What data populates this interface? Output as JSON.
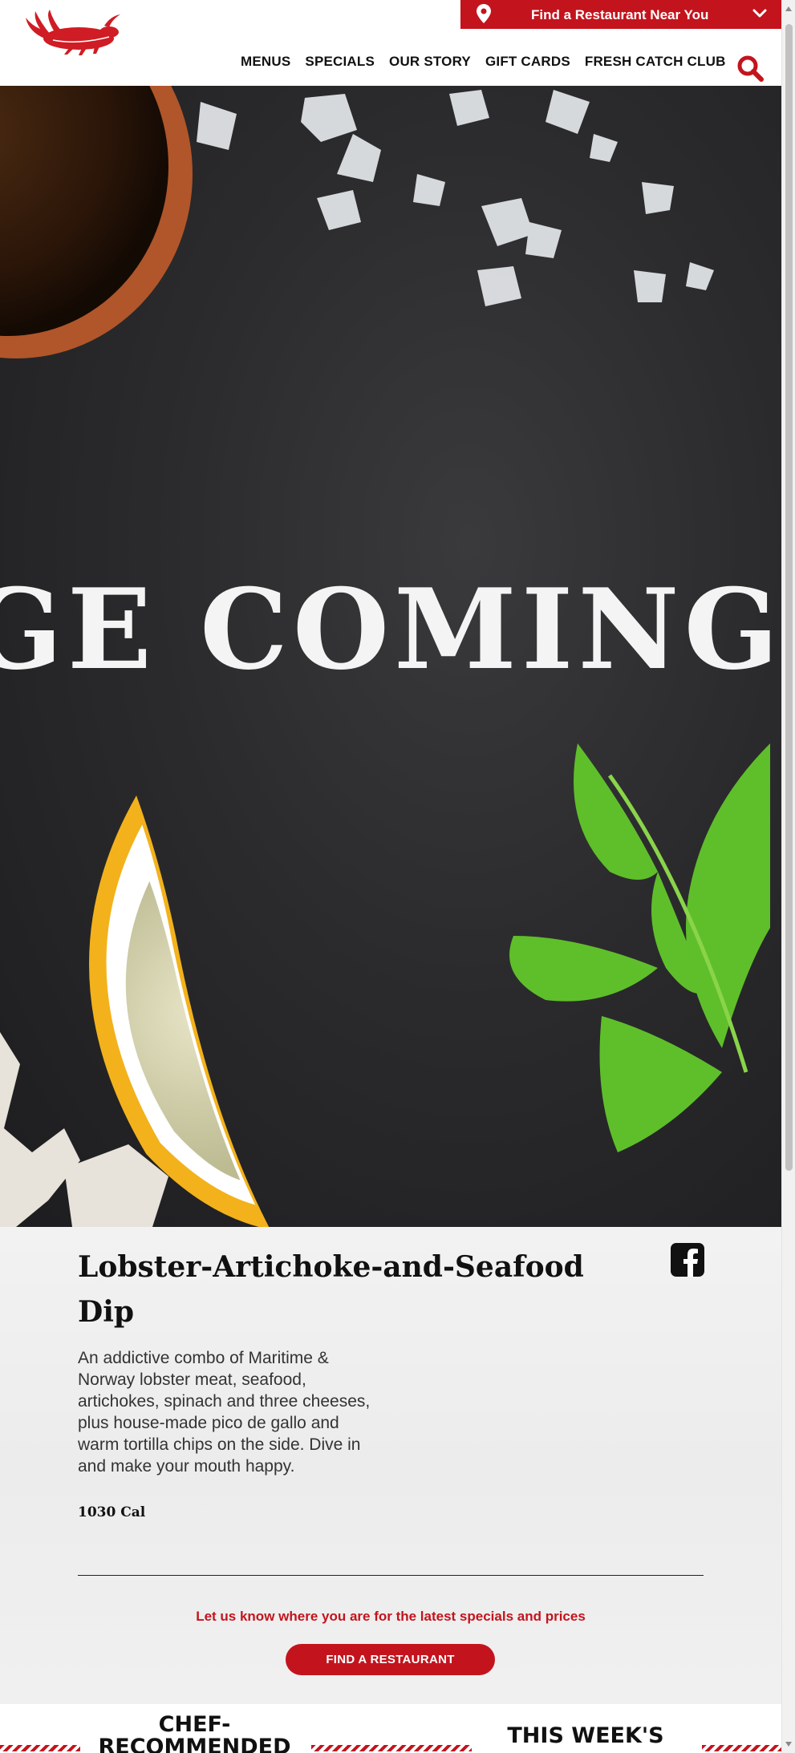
{
  "header": {
    "find_bar_label": "Find a Restaurant Near You",
    "nav": [
      "MENUS",
      "SPECIALS",
      "OUR STORY",
      "GIFT CARDS",
      "FRESH CATCH CLUB"
    ],
    "icons": {
      "logo": "lobster-logo-icon",
      "location": "map-pin-icon",
      "dropdown": "chevron-down-icon",
      "search": "search-icon"
    }
  },
  "hero": {
    "overlay_text": "GE COMING S"
  },
  "dish": {
    "title": "Lobster-Artichoke-and-Seafood Dip",
    "description": "An addictive combo of Maritime & Norway lobster meat, seafood, artichokes, spinach and three cheeses, plus house-made pico de gallo and warm tortilla chips on the side. Dive in and make your mouth happy.",
    "calories": "1030 Cal",
    "share_icon": "facebook-icon"
  },
  "cta": {
    "text": "Let us know where you are for the latest specials and prices",
    "button_label": "FIND A RESTAURANT"
  },
  "sections": {
    "chef_recommended": [
      "CHEF-",
      "RECOMMENDED"
    ],
    "this_weeks": "THIS WEEK'S"
  },
  "colors": {
    "brand_red": "#c3141d",
    "hero_dark": "#2b2b2d",
    "text_dark": "#111111"
  }
}
